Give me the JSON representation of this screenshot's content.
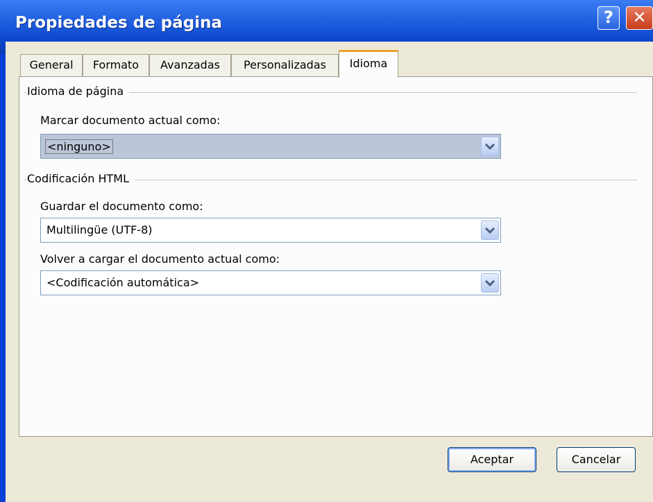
{
  "window": {
    "title": "Propiedades de página"
  },
  "titlebar": {
    "help_label": "?",
    "close_label": "✕"
  },
  "tabs": [
    {
      "label": "General"
    },
    {
      "label": "Formato"
    },
    {
      "label": "Avanzadas"
    },
    {
      "label": "Personalizadas"
    },
    {
      "label": "Idioma"
    }
  ],
  "active_tab": "Idioma",
  "page_language": {
    "group_title": "Idioma de página",
    "mark_label": "Marcar documento actual como:",
    "mark_value": "<ninguno>"
  },
  "html_encoding": {
    "group_title": "Codificación HTML",
    "save_label": "Guardar el documento como:",
    "save_value": "Multilingüe (UTF-8)",
    "reload_label": "Volver a cargar el documento actual como:",
    "reload_value": "<Codificación automática>"
  },
  "buttons": {
    "ok": "Aceptar",
    "cancel": "Cancelar"
  },
  "colors": {
    "titlebar": "#1f5fe0",
    "dialog_bg": "#ece9d8",
    "active_tab_accent": "#f0a030"
  },
  "icons": {
    "help": "help-icon",
    "close": "close-icon",
    "dropdown": "chevron-down-icon"
  }
}
